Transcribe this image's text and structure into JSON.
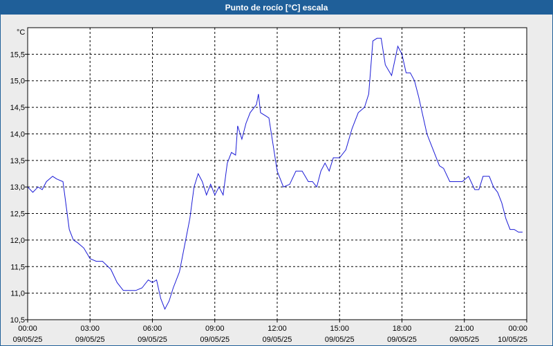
{
  "window": {
    "title": "Punto de rocío [°C] escala"
  },
  "colors": {
    "titlebar": "#1f5f99",
    "line": "#1a1ad6",
    "plot_bg": "#ffffff",
    "frame_bg": "#ececec"
  },
  "chart_data": {
    "type": "line",
    "title": "Punto de rocío [°C] escala",
    "unit_label": "°C",
    "xlabel": "",
    "ylabel": "",
    "grid": true,
    "ylim": [
      10.5,
      16.0
    ],
    "y_ticks": [
      "10,5",
      "11,0",
      "11,5",
      "12,0",
      "12,5",
      "13,0",
      "13,5",
      "14,0",
      "14,5",
      "15,0",
      "15,5"
    ],
    "x_ticks": [
      {
        "time": "00:00",
        "date": "09/05/25"
      },
      {
        "time": "03:00",
        "date": "09/05/25"
      },
      {
        "time": "06:00",
        "date": "09/05/25"
      },
      {
        "time": "09:00",
        "date": "09/05/25"
      },
      {
        "time": "12:00",
        "date": "09/05/25"
      },
      {
        "time": "15:00",
        "date": "09/05/25"
      },
      {
        "time": "18:00",
        "date": "09/05/25"
      },
      {
        "time": "21:00",
        "date": "09/05/25"
      },
      {
        "time": "00:00",
        "date": "10/05/25"
      }
    ],
    "x_range_hours": [
      0,
      24
    ],
    "series": [
      {
        "x": [
          0,
          0.25,
          0.5,
          0.7,
          0.9,
          1.2,
          1.4,
          1.7,
          2.0,
          2.2,
          2.4,
          2.7,
          3.0,
          3.3,
          3.6,
          4.0,
          4.3,
          4.6,
          4.9,
          5.2,
          5.5,
          5.8,
          6.0,
          6.2,
          6.4,
          6.6,
          6.8,
          7.0,
          7.3,
          7.6,
          7.8,
          8.0,
          8.2,
          8.4,
          8.6,
          8.8,
          9.0,
          9.2,
          9.4,
          9.6,
          9.8,
          10.0,
          10.1,
          10.3,
          10.5,
          10.7,
          10.9,
          11.0,
          11.1,
          11.2,
          11.4,
          11.6,
          11.8,
          12.0,
          12.3,
          12.6,
          12.9,
          13.2,
          13.5,
          13.7,
          13.9,
          14.1,
          14.3,
          14.5,
          14.7,
          15.0,
          15.3,
          15.6,
          15.9,
          16.2,
          16.4,
          16.6,
          16.8,
          17.0,
          17.2,
          17.5,
          17.8,
          18.0,
          18.2,
          18.4,
          18.6,
          18.8,
          19.0,
          19.2,
          19.4,
          19.6,
          19.8,
          20.0,
          20.3,
          20.6,
          20.9,
          21.2,
          21.5,
          21.7,
          21.9,
          22.2,
          22.4,
          22.6,
          22.8,
          23.0,
          23.2,
          23.4,
          23.6,
          23.8
        ],
        "values": [
          13.0,
          12.9,
          13.0,
          12.95,
          13.1,
          13.2,
          13.15,
          13.1,
          12.2,
          12.0,
          11.95,
          11.85,
          11.65,
          11.6,
          11.6,
          11.45,
          11.2,
          11.05,
          11.05,
          11.05,
          11.1,
          11.25,
          11.2,
          11.25,
          10.9,
          10.7,
          10.85,
          11.1,
          11.4,
          12.0,
          12.4,
          13.0,
          13.25,
          13.1,
          12.85,
          13.05,
          12.85,
          13.0,
          12.85,
          13.45,
          13.65,
          13.6,
          14.15,
          13.9,
          14.2,
          14.4,
          14.5,
          14.55,
          14.75,
          14.4,
          14.35,
          14.3,
          13.8,
          13.3,
          13.0,
          13.05,
          13.3,
          13.3,
          13.1,
          13.1,
          13.0,
          13.3,
          13.45,
          13.3,
          13.55,
          13.55,
          13.7,
          14.1,
          14.4,
          14.5,
          14.75,
          15.75,
          15.8,
          15.8,
          15.3,
          15.1,
          15.65,
          15.5,
          15.15,
          15.15,
          15.0,
          14.7,
          14.35,
          14.0,
          13.8,
          13.6,
          13.4,
          13.35,
          13.1,
          13.1,
          13.1,
          13.2,
          12.95,
          12.95,
          13.2,
          13.2,
          13.0,
          12.9,
          12.7,
          12.4,
          12.2,
          12.2,
          12.15,
          12.15
        ]
      }
    ]
  }
}
